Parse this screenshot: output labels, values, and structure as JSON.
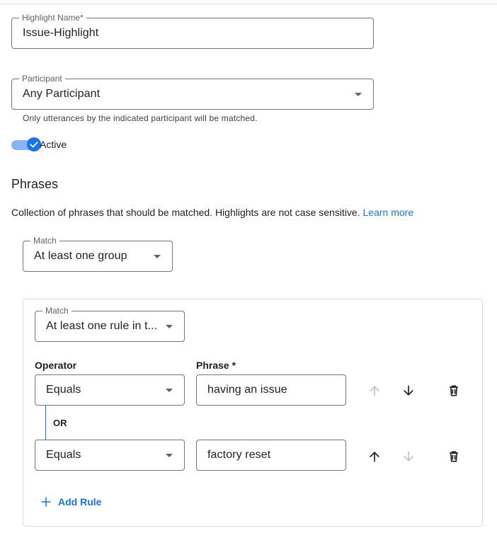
{
  "highlight_name": {
    "label": "Highlight Name*",
    "value": "Issue-Highlight"
  },
  "participant": {
    "label": "Participant",
    "value": "Any Participant",
    "hint": "Only utterances by the indicated participant will be matched."
  },
  "active_toggle": {
    "label": "Active",
    "checked": true
  },
  "phrases": {
    "title": "Phrases",
    "description": "Collection of phrases that should be matched. Highlights are not case sensitive.",
    "learn_more": "Learn more",
    "match": {
      "label": "Match",
      "value": "At least one group"
    },
    "group": {
      "match": {
        "label": "Match",
        "value": "At least one rule in t..."
      },
      "operator_header": "Operator",
      "phrase_header": "Phrase *",
      "connector": "OR",
      "rules": [
        {
          "operator": "Equals",
          "phrase": "having an issue",
          "move_up_enabled": false,
          "move_down_enabled": true
        },
        {
          "operator": "Equals",
          "phrase": "factory reset",
          "move_up_enabled": true,
          "move_down_enabled": false
        }
      ],
      "add_rule_label": "Add Rule"
    }
  },
  "colors": {
    "accent": "#1a73e8",
    "toggle_track": "#8ab4f8",
    "border": "#757575",
    "card_border": "#dadce0",
    "disabled_icon": "#bdc1c6"
  }
}
